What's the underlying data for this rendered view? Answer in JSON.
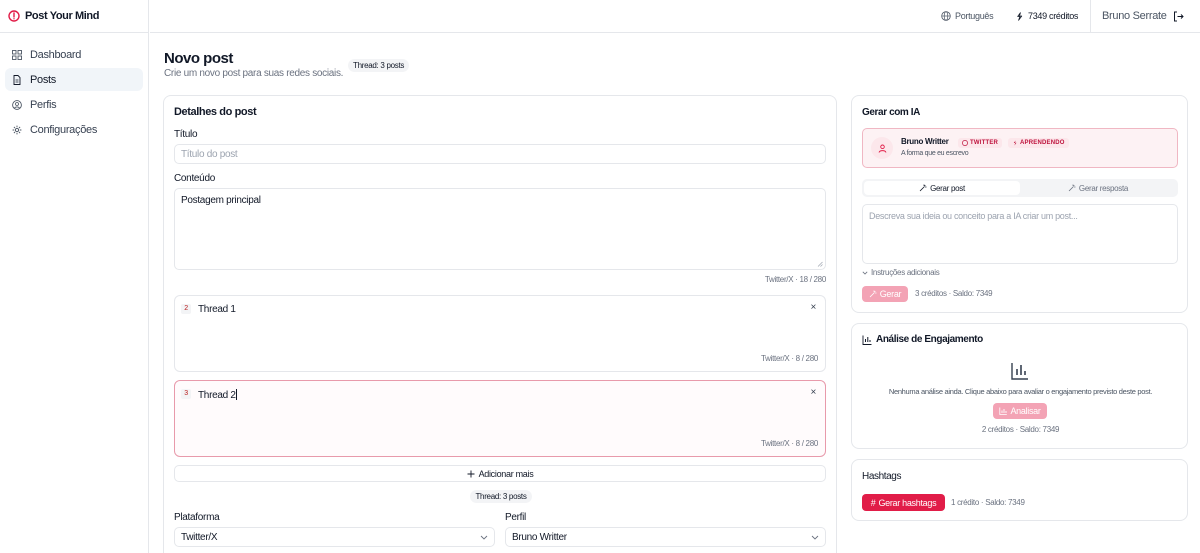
{
  "app": {
    "name": "Post Your Mind",
    "accent": "#e11d48"
  },
  "sidebar": {
    "items": [
      {
        "label": "Dashboard",
        "icon": "grid-icon",
        "active": false
      },
      {
        "label": "Posts",
        "icon": "document-icon",
        "active": true
      },
      {
        "label": "Perfis",
        "icon": "user-circle-icon",
        "active": false
      },
      {
        "label": "Configurações",
        "icon": "gear-icon",
        "active": false
      }
    ]
  },
  "topbar": {
    "language": "Português",
    "credits": "7349 créditos",
    "user": "Bruno Serrate"
  },
  "page": {
    "title": "Novo post",
    "subtitle": "Crie um novo post para suas redes sociais.",
    "thread_pill": "Thread: 3 posts"
  },
  "details": {
    "title": "Detalhes do post",
    "title_label": "Título",
    "title_placeholder": "Título do post",
    "content_label": "Conteúdo",
    "content_value": "Postagem principal",
    "content_counter": "Twitter/X · 18 / 280",
    "threads": [
      {
        "num": "2",
        "text": "Thread 1",
        "counter": "Twitter/X · 8 / 280"
      },
      {
        "num": "3",
        "text": "Thread 2",
        "counter": "Twitter/X · 8 / 280"
      }
    ],
    "close_symbol": "×",
    "add_more": "Adicionar mais",
    "thread_summary": "Thread: 3 posts",
    "platform_label": "Plataforma",
    "platform_value": "Twitter/X",
    "profile_label": "Perfil",
    "profile_value": "Bruno Writter"
  },
  "ai": {
    "title": "Gerar com IA",
    "profile_name": "Bruno Writter",
    "profile_desc": "A forma que eu escrevo",
    "badge_platform": "TWITTER",
    "badge_status": "APRENDENDO",
    "tab_post": "Gerar post",
    "tab_reply": "Gerar resposta",
    "prompt_placeholder": "Descreva sua ideia ou conceito para a IA criar um post...",
    "extra": "Instruções adicionais",
    "generate_btn": "Gerar",
    "cost": "3 créditos · Saldo: 7349"
  },
  "engagement": {
    "title": "Análise de Engajamento",
    "empty": "Nenhuma análise ainda. Clique abaixo para avaliar o engajamento previsto deste post.",
    "analyze_btn": "Analisar",
    "cost": "2 créditos · Saldo: 7349"
  },
  "hashtags": {
    "title": "Hashtags",
    "btn": "Gerar hashtags",
    "cost": "1 crédito · Saldo: 7349"
  }
}
